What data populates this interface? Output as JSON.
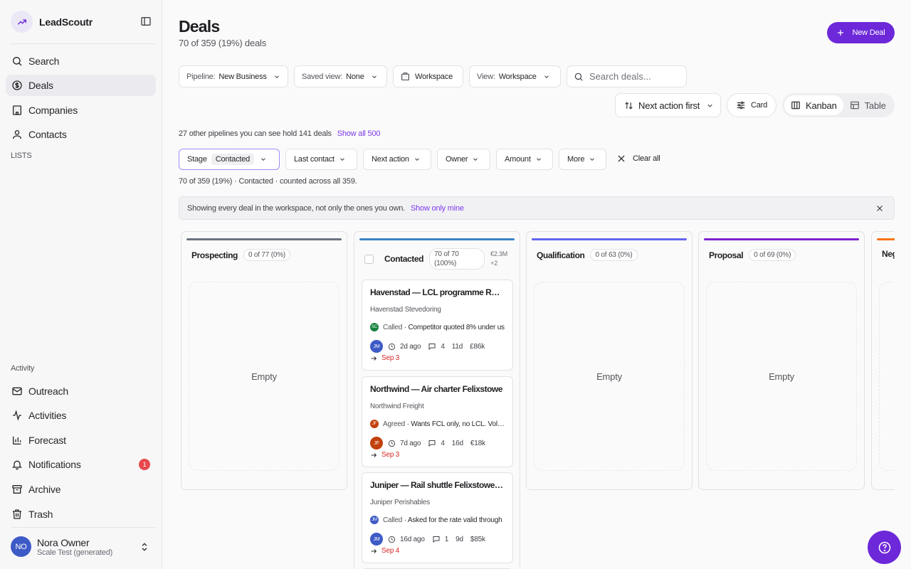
{
  "app": {
    "name": "LeadScoutr"
  },
  "sidebar": {
    "nav": [
      {
        "label": "Search",
        "icon": "search-icon"
      },
      {
        "label": "Deals",
        "icon": "dollar-circle-icon"
      },
      {
        "label": "Companies",
        "icon": "building-icon"
      },
      {
        "label": "Contacts",
        "icon": "user-icon"
      }
    ],
    "lists_label": "LISTS",
    "activity_label": "Activity",
    "activity_items": [
      {
        "label": "Outreach",
        "icon": "mail-icon"
      },
      {
        "label": "Activities",
        "icon": "activity-icon"
      },
      {
        "label": "Forecast",
        "icon": "bar-chart-icon"
      },
      {
        "label": "Notifications",
        "icon": "bell-icon",
        "badge": "1"
      },
      {
        "label": "Archive",
        "icon": "archive-icon"
      },
      {
        "label": "Trash",
        "icon": "trash-icon"
      }
    ],
    "user": {
      "initials": "NO",
      "name": "Nora Owner",
      "workspace": "Scale Test (generated)"
    }
  },
  "header": {
    "title": "Deals",
    "subtitle": "70 of 359 (19%) deals",
    "new_deal_label": "New Deal"
  },
  "toolbar": {
    "pipeline_label": "Pipeline:",
    "pipeline_value": "New Business",
    "saved_view_label": "Saved view:",
    "saved_view_value": "None",
    "workspace_label": "Workspace",
    "view_label": "View:",
    "view_value": "Workspace",
    "search_placeholder": "Search deals...",
    "sort_label": "Next action first",
    "card_label": "Card",
    "kanban_label": "Kanban",
    "table_label": "Table"
  },
  "pipelines_info": {
    "text": "27 other pipelines you can see hold 141 deals",
    "link": "Show all 500"
  },
  "filters": {
    "stage_label": "Stage",
    "stage_value": "Contacted",
    "last_contact": "Last contact",
    "next_action": "Next action",
    "owner": "Owner",
    "amount": "Amount",
    "more": "More",
    "clear_all": "Clear all"
  },
  "count_line": "70 of 359 (19%) · Contacted · counted across all 359.",
  "notice": {
    "text": "Showing every deal in the workspace, not only the ones you own.",
    "link": "Show only mine"
  },
  "columns": [
    {
      "title": "Prospecting",
      "count": "0 of 77 (0%)",
      "empty_label": "Empty",
      "color": "#6b7280"
    },
    {
      "title": "Contacted",
      "count": "70 of 70 (100%)",
      "amount": "€2.3M",
      "extra": "+2",
      "color": "#3b82c4"
    },
    {
      "title": "Qualification",
      "count": "0 of 63 (0%)",
      "empty_label": "Empty",
      "color": "#6366f1"
    },
    {
      "title": "Proposal",
      "count": "0 of 69 (0%)",
      "empty_label": "Empty",
      "color": "#7e22ce"
    },
    {
      "title": "Neg",
      "color": "#f97316"
    }
  ],
  "deals": [
    {
      "title": "Havenstad — LCL programme Rotterdam",
      "company": "Havenstad Stevedoring",
      "note_initials": "SC",
      "note_color": "#15803d",
      "note_kind": "Called",
      "note_text": "Competitor quoted 8% under us",
      "owner_initials": "JM",
      "owner_color": "#3d5ac6",
      "ago": "2d ago",
      "comments": "4",
      "age": "11d",
      "amount": "£86k",
      "due": "Sep 3"
    },
    {
      "title": "Northwind — Air charter Felixstowe",
      "company": "Northwind Freight",
      "note_initials": "JF",
      "note_color": "#c2410c",
      "note_kind": "Agreed",
      "note_text": "Wants FCL only, no LCL. Volume",
      "owner_initials": "JF",
      "owner_color": "#c2410c",
      "ago": "7d ago",
      "comments": "4",
      "age": "16d",
      "amount": "€18k",
      "due": "Sep 3"
    },
    {
      "title": "Juniper — Rail shuttle Felixstowe–Chester",
      "company": "Juniper Perishables",
      "note_initials": "JM",
      "note_color": "#3d5ac6",
      "note_kind": "Called",
      "note_text": "Asked for the rate valid through",
      "owner_initials": "JM",
      "owner_color": "#3d5ac6",
      "ago": "16d ago",
      "comments": "1",
      "age": "9d",
      "amount": "$85k",
      "due": "Sep 4"
    }
  ]
}
